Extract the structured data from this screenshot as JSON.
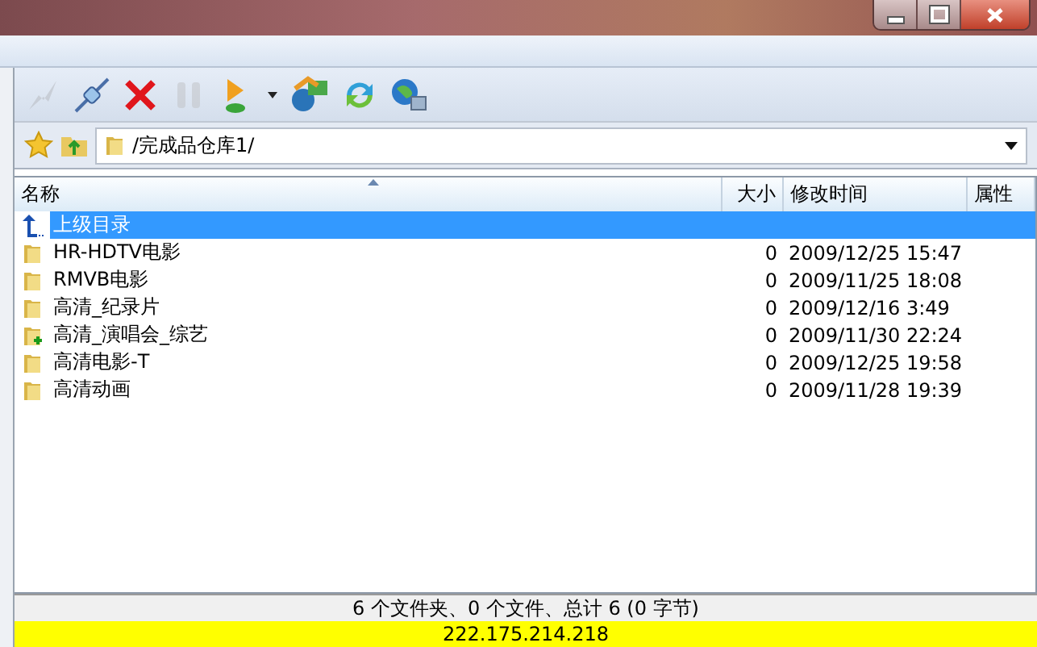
{
  "window": {
    "controls": [
      {
        "kind": "minimize"
      },
      {
        "kind": "restore"
      },
      {
        "kind": "close"
      }
    ]
  },
  "toolbar": [
    {
      "kind": "disconnect",
      "disabled": true
    },
    {
      "kind": "connect",
      "disabled": false
    },
    {
      "kind": "stop",
      "disabled": false
    },
    {
      "kind": "pause",
      "disabled": true
    },
    {
      "kind": "go",
      "disabled": false
    },
    {
      "kind": "dropdown",
      "disabled": false
    },
    {
      "kind": "transfer",
      "disabled": false
    },
    {
      "kind": "refresh",
      "disabled": false
    },
    {
      "kind": "site",
      "disabled": false
    }
  ],
  "address_bar": {
    "value": "/完成品仓库1/"
  },
  "file_list": {
    "columns": [
      {
        "label": "名称",
        "sorted": true
      },
      {
        "label": "大小",
        "sorted": false
      },
      {
        "label": "修改时间",
        "sorted": false
      },
      {
        "label": "属性",
        "sorted": false
      }
    ],
    "rows": [
      {
        "kind": "parent",
        "name": "上级目录",
        "selected": true
      },
      {
        "kind": "folder",
        "name": "HR-HDTV电影",
        "size": "0",
        "modified": "2009/12/25 15:47",
        "selected": false
      },
      {
        "kind": "folder",
        "name": "RMVB电影",
        "size": "0",
        "modified": "2009/11/25 18:08",
        "selected": false
      },
      {
        "kind": "folder",
        "name": "高清_纪录片",
        "size": "0",
        "modified": "2009/12/16 3:49",
        "selected": false
      },
      {
        "kind": "folder-added",
        "name": "高清_演唱会_综艺",
        "size": "0",
        "modified": "2009/11/30 22:24",
        "selected": false
      },
      {
        "kind": "folder",
        "name": "高清电影-T",
        "size": "0",
        "modified": "2009/12/25 19:58",
        "selected": false
      },
      {
        "kind": "folder",
        "name": "高清动画",
        "size": "0",
        "modified": "2009/11/28 19:39",
        "selected": false
      }
    ]
  },
  "status_bar": {
    "summary": "6 个文件夹、0 个文件、总计 6 (0 字节)",
    "address": "222.175.214.218"
  }
}
